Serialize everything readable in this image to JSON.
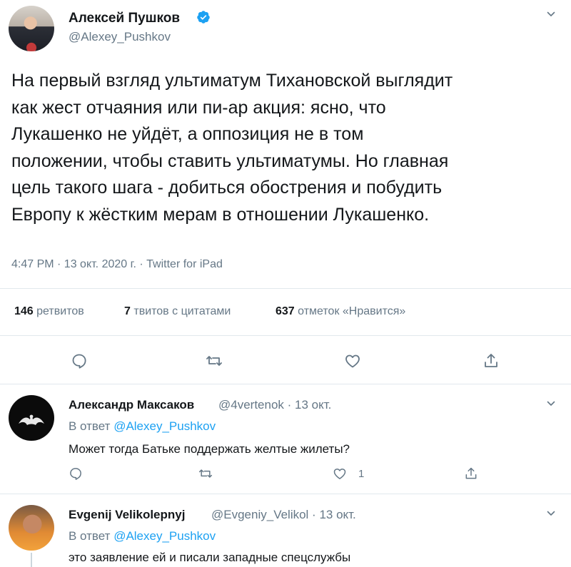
{
  "main": {
    "author_name": "Алексей Пушков",
    "author_handle": "@Alexey_Pushkov",
    "text_lines": [
      "На первый взгляд ультиматум Тихановской выглядит",
      "как жест отчаяния или пи-ар акция: ясно, что",
      "Лукашенко не уйдёт, а оппозиция не в том",
      "положении, чтобы ставить ультиматумы. Но главная",
      "цель такого шага - добиться обострения и побудить",
      "Европу к жёстким мерам в отношении Лукашенко."
    ],
    "timestamp": "4:47 PM · 13 окт. 2020 г. · Twitter for iPad",
    "stats": {
      "retweets_count": "146",
      "retweets_label": "ретвитов",
      "quotes_count": "7",
      "quotes_label": "твитов с цитатами",
      "likes_count": "637",
      "likes_label": "отметок «Нравится»"
    }
  },
  "replies": [
    {
      "name": "Александр Максаков",
      "handle_date": "@4vertenok · 13 окт.",
      "reply_prefix": "В ответ",
      "reply_to": "@Alexey_Pushkov",
      "text": "Может тогда Батьке поддержать желтые жилеты?",
      "like_count": "1"
    },
    {
      "name": "Evgenij Velikolepnyj",
      "handle_date": "@Evgeniy_Velikol · 13 окт.",
      "reply_prefix": "В ответ",
      "reply_to": "@Alexey_Pushkov",
      "text": "это заявление ей и писали западные спецслужбы"
    }
  ],
  "icons": {
    "verified": "verified-badge-icon",
    "reply": "reply-icon",
    "retweet": "retweet-icon",
    "like": "like-icon",
    "share": "share-icon",
    "more": "chevron-down-icon"
  },
  "colors": {
    "accent": "#1da1f2",
    "secondary_text": "#657786",
    "primary_text": "#14171a",
    "divider": "#e1e8ed"
  }
}
